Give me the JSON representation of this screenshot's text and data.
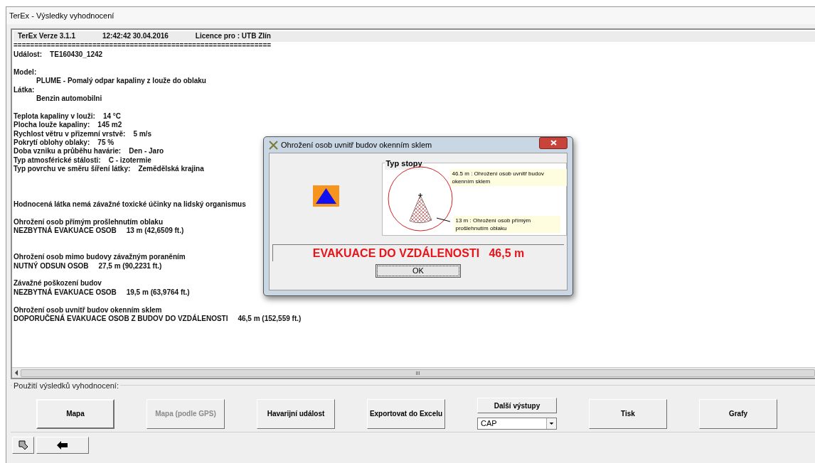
{
  "window": {
    "title": "TerEx - Výsledky vyhodnocení"
  },
  "report": {
    "header": [
      "TerEx  Verze 3.1.1",
      "12:42:42  30.04.2016",
      "Licence pro : UTB Zlín"
    ],
    "lines": [
      {
        "kind": "line",
        "text": "=============================================================="
      },
      {
        "kind": "line",
        "text": "Událost:    TE160430_1242"
      },
      {
        "kind": "break"
      },
      {
        "kind": "line",
        "text": "Model:"
      },
      {
        "kind": "indented",
        "text": "PLUME - Pomalý odpar kapaliny z louže do oblaku"
      },
      {
        "kind": "line",
        "text": "Látka:"
      },
      {
        "kind": "indented",
        "text": "Benzin automobilni"
      },
      {
        "kind": "break"
      },
      {
        "kind": "line",
        "text": "Teplota kapaliny v louži:    14 °C"
      },
      {
        "kind": "line",
        "text": "Plocha louže kapaliny:    145 m2"
      },
      {
        "kind": "line",
        "text": "Rychlost větru v přizemní vrstvě:    5 m/s"
      },
      {
        "kind": "line",
        "text": "Pokrytí oblohy oblaky:    75 %"
      },
      {
        "kind": "line",
        "text": "Doba vzniku a průběhu havárie:    Den - Jaro"
      },
      {
        "kind": "line",
        "text": "Typ atmosférické stálosti:    C - izotermie"
      },
      {
        "kind": "line",
        "text": "Typ povrchu ve směru šíření látky:    Zemědělská krajina"
      },
      {
        "kind": "break"
      },
      {
        "kind": "break"
      },
      {
        "kind": "break"
      },
      {
        "kind": "line",
        "text": "Hodnocená látka nemá závažné toxické účinky na lidský organismus"
      },
      {
        "kind": "break"
      },
      {
        "kind": "line",
        "text": "Ohrožení osob přímým prošlehnutím oblaku"
      },
      {
        "kind": "line",
        "text": "NEZBYTNÁ EVAKUACE OSOB     13 m (42,6509 ft.)"
      },
      {
        "kind": "break"
      },
      {
        "kind": "break"
      },
      {
        "kind": "line",
        "text": "Ohrožení osob mimo budovy závažným poraněním"
      },
      {
        "kind": "line",
        "text": "NUTNÝ ODSUN OSOB     27,5 m (90,2231 ft.)"
      },
      {
        "kind": "break"
      },
      {
        "kind": "line",
        "text": "Závažné poškození budov"
      },
      {
        "kind": "line",
        "text": "NEZBYTNÁ EVAKUACE OSOB     19,5 m (63,9764 ft.)"
      },
      {
        "kind": "break"
      },
      {
        "kind": "line",
        "text": "Ohrožení osob uvnitř budov okenním sklem"
      },
      {
        "kind": "line",
        "text": "DOPORUČENÁ EVAKUACE OSOB Z BUDOV DO VZDÁLENOSTI     46,5 m (152,559 ft.)"
      }
    ]
  },
  "dialog": {
    "title": "Ohrožení osob uvnitř budov okenním sklem",
    "group_label": "Typ stopy",
    "outer_zone_label": "46.5 m : Ohrožení osob uvnitř budov okenním sklem",
    "inner_zone_label": "13 m : Ohrožení osob přímým prošlehnutím oblaku",
    "result": "EVAKUACE DO VZDÁLENOSTI   46,5 m",
    "ok_button": "OK"
  },
  "actions": {
    "label": "Použití výsledků vyhodnocení:",
    "buttons": [
      {
        "kind": "button",
        "label": "Mapa",
        "default": true,
        "disabled": false
      },
      {
        "kind": "button",
        "label": "Mapa (podle GPS)",
        "default": false,
        "disabled": true
      },
      {
        "kind": "button",
        "label": "Havarijní událost",
        "default": false,
        "disabled": false
      },
      {
        "kind": "button",
        "label": "Exportovat do Excelu",
        "default": false,
        "disabled": false
      },
      {
        "kind": "output",
        "label": "Další výstupy",
        "default": false,
        "disabled": false,
        "value": "CAP"
      },
      {
        "kind": "button",
        "label": "Tisk",
        "default": false,
        "disabled": false
      },
      {
        "kind": "button",
        "label": "Grafy",
        "default": false,
        "disabled": false
      }
    ]
  }
}
